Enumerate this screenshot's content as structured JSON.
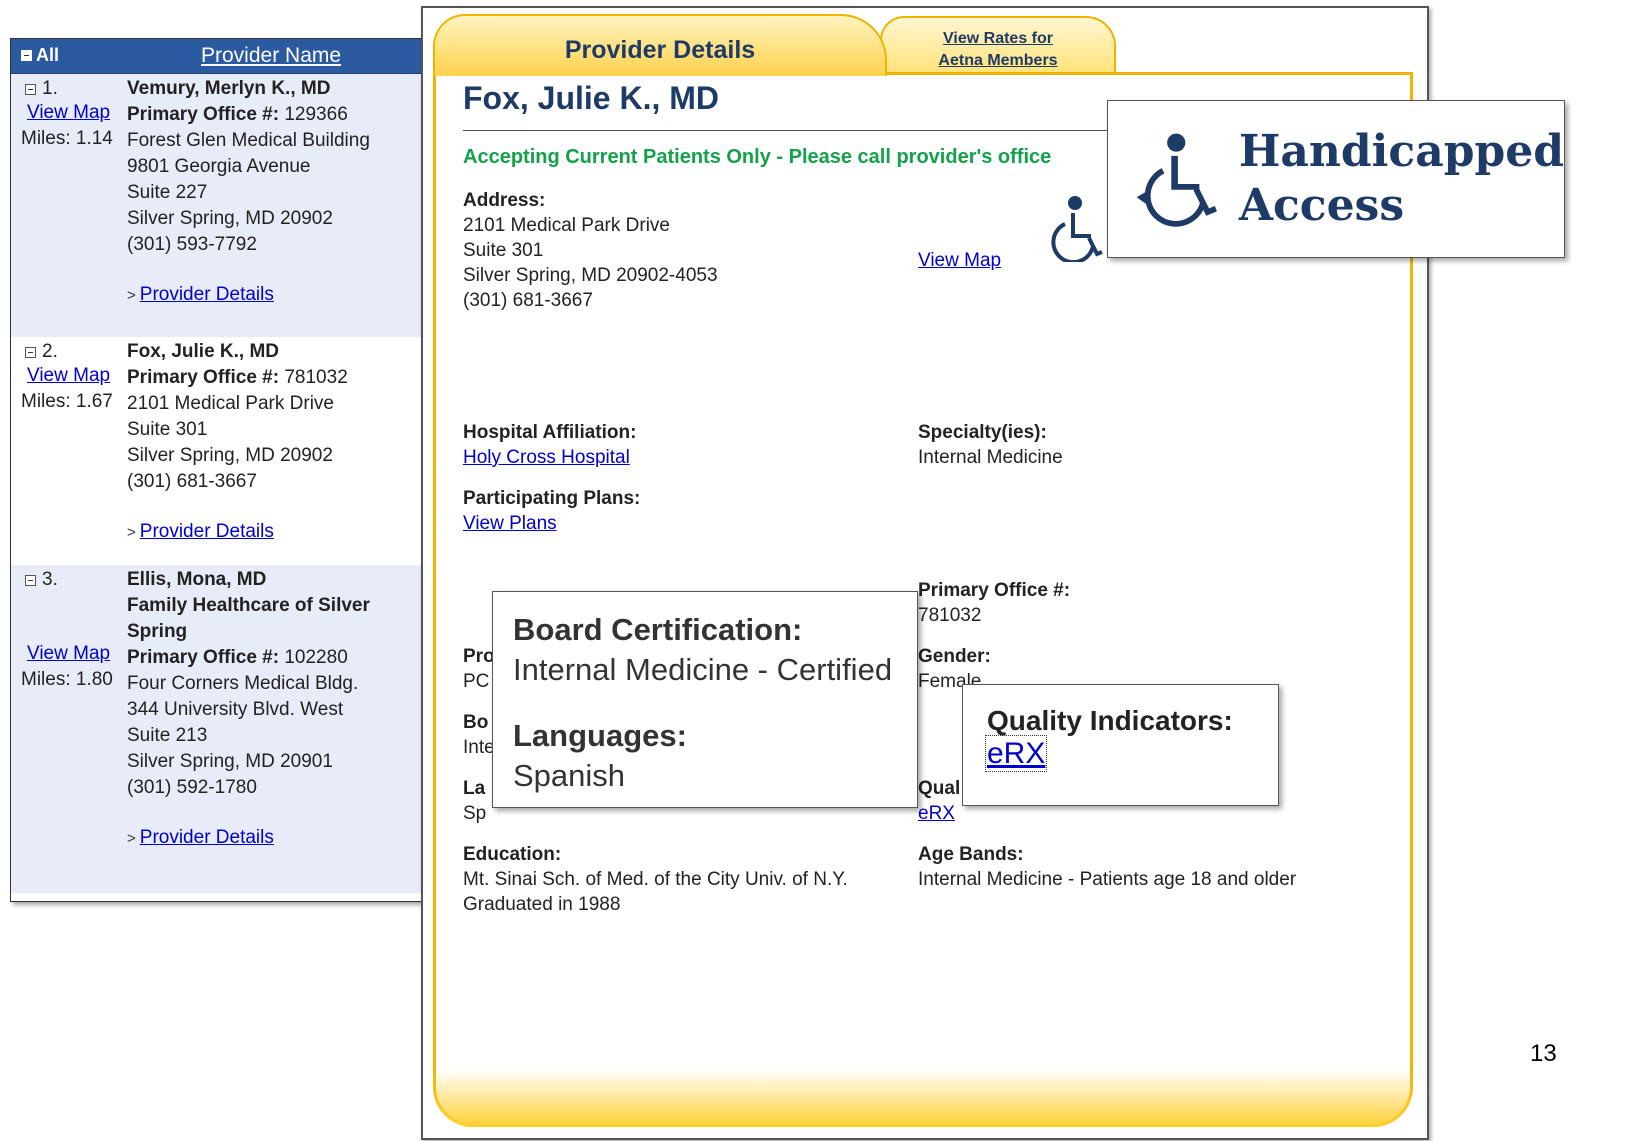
{
  "list": {
    "header_all": "All",
    "header_provider_name": "Provider Name",
    "view_map": "View Map",
    "primary_office_label": "Primary Office #:",
    "provider_details": "Provider Details",
    "providers": [
      {
        "num": "1.",
        "name": "Vemury, Merlyn K., MD",
        "office": "129366",
        "miles": "Miles: 1.14",
        "address": [
          "Forest Glen Medical Building",
          "9801 Georgia Avenue",
          "Suite 227",
          "Silver Spring, MD 20902",
          "(301) 593-7792"
        ]
      },
      {
        "num": "2.",
        "name": "Fox, Julie K., MD",
        "office": "781032",
        "miles": "Miles: 1.67",
        "address": [
          "2101 Medical Park Drive",
          "Suite 301",
          "Silver Spring, MD 20902",
          "(301) 681-3667"
        ]
      },
      {
        "num": "3.",
        "name": "Ellis, Mona, MD",
        "name2": "Family Healthcare of Silver Spring",
        "office": "102280",
        "miles": "Miles: 1.80",
        "address": [
          "Four Corners Medical Bldg.",
          "344 University Blvd. West",
          "Suite 213",
          "Silver Spring, MD 20901",
          "(301) 592-1780"
        ]
      }
    ]
  },
  "detail": {
    "tab_active": "Provider Details",
    "tab_rates_line1": "View Rates for",
    "tab_rates_line2": "Aetna Members",
    "provider_name": "Fox, Julie K., MD",
    "accepting": "Accepting Current Patients Only - Please call provider's office",
    "address_label": "Address:",
    "address": [
      "2101 Medical Park Drive",
      "Suite 301",
      "Silver Spring, MD 20902-4053",
      "(301) 681-3667"
    ],
    "view_map": "View Map",
    "hospital_label": "Hospital Affiliation:",
    "hospital": "Holy Cross Hospital",
    "specialty_label": "Specialty(ies):",
    "specialty": "Internal Medicine",
    "plans_label": "Participating Plans:",
    "plans": "View Plans",
    "office_label": "Primary Office #:",
    "office": "781032",
    "program_label": "Pro",
    "program": "PC",
    "gender_label": "Gender:",
    "gender": "Female",
    "board_label": "Bo",
    "board": "Inte",
    "languages_label": "La",
    "languages": "Sp",
    "quality_label": "Qual",
    "quality": "eRX",
    "education_label": "Education:",
    "education": [
      "Mt. Sinai Sch. of Med. of the City Univ. of N.Y.",
      "Graduated in 1988"
    ],
    "ages_label": "Age Bands:",
    "ages": "Internal Medicine - Patients age 18 and older"
  },
  "callouts": {
    "handicap_line1": "Handicapped",
    "handicap_line2": "Access",
    "board_label": "Board Certification:",
    "board_value": "Internal Medicine - Certified",
    "languages_label": "Languages:",
    "languages_value": "Spanish",
    "quality_label": "Quality Indicators:",
    "quality_value": "eRX"
  },
  "page_number": "13",
  "colors": {
    "header_blue": "#2b5aa0",
    "navy_text": "#1e3a66",
    "accent_gold": "#f0b400",
    "accept_green": "#13a14a",
    "link_blue": "#0000cc"
  },
  "icons": [
    "minus-box-icon",
    "chevron-right-icon",
    "wheelchair-icon"
  ]
}
